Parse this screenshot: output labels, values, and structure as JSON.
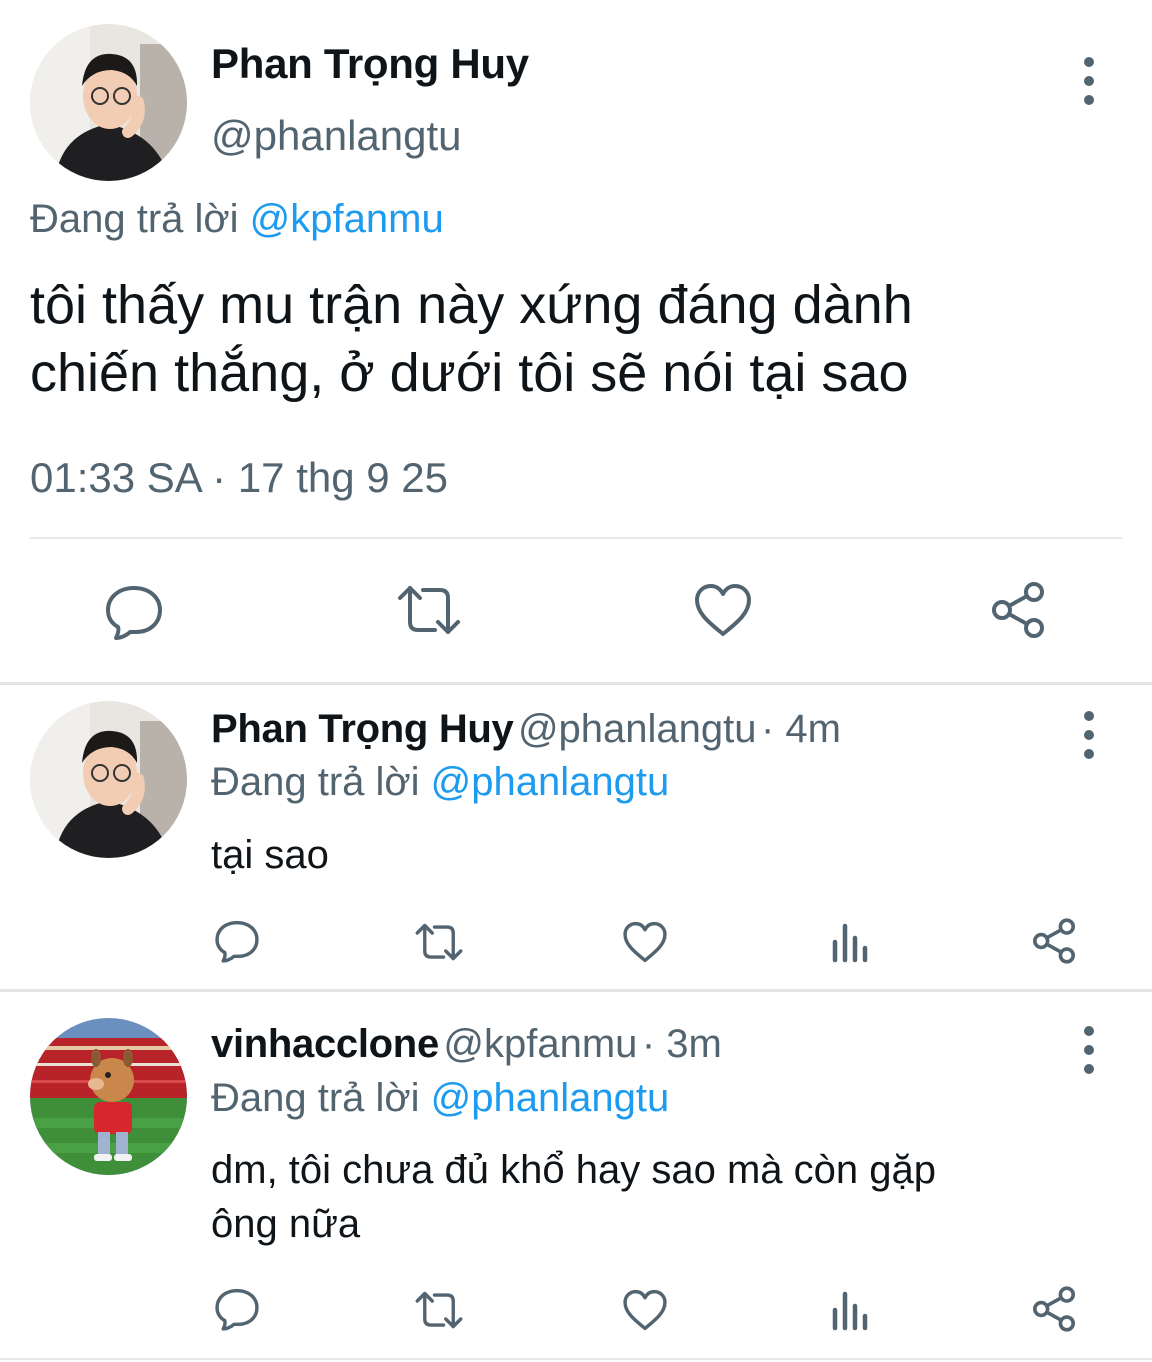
{
  "main_tweet": {
    "author_name": "Phan Trọng Huy",
    "author_handle": "@phanlangtu",
    "reply_prefix": "Đang trả lời",
    "reply_to": "@kpfanmu",
    "text_line1": "tôi thấy mu trận này xứng đáng dành",
    "text_line2": "chiến thắng, ở dưới tôi sẽ nói tại sao",
    "time": "01:33 SA",
    "separator": " · ",
    "date": "17 thg 9 25",
    "actions": [
      "reply-icon",
      "retweet-icon",
      "like-icon",
      "share-icon"
    ]
  },
  "replies": [
    {
      "author_name": "Phan Trọng Huy",
      "author_handle": "@phanlangtu",
      "time_ago": "· 4m",
      "reply_prefix": "Đang trả lời",
      "reply_to": "@phanlangtu",
      "text": "tại sao",
      "actions": [
        "reply-icon",
        "retweet-icon",
        "like-icon",
        "views-icon",
        "share-icon"
      ]
    },
    {
      "author_name": "vinhacclone",
      "author_handle": "@kpfanmu",
      "time_ago": "· 3m",
      "reply_prefix": "Đang trả lời",
      "reply_to": "@phanlangtu",
      "text_line1": "dm, tôi chưa đủ khổ hay sao mà còn gặp",
      "text_line2": "ông nữa",
      "actions": [
        "reply-icon",
        "retweet-icon",
        "like-icon",
        "views-icon",
        "share-icon"
      ]
    }
  ],
  "icons": {
    "more": "more-vertical-icon"
  },
  "colors": {
    "text": "#0f1419",
    "secondary": "#536471",
    "link": "#1d9bf0",
    "divider": "#e6e9ec"
  }
}
